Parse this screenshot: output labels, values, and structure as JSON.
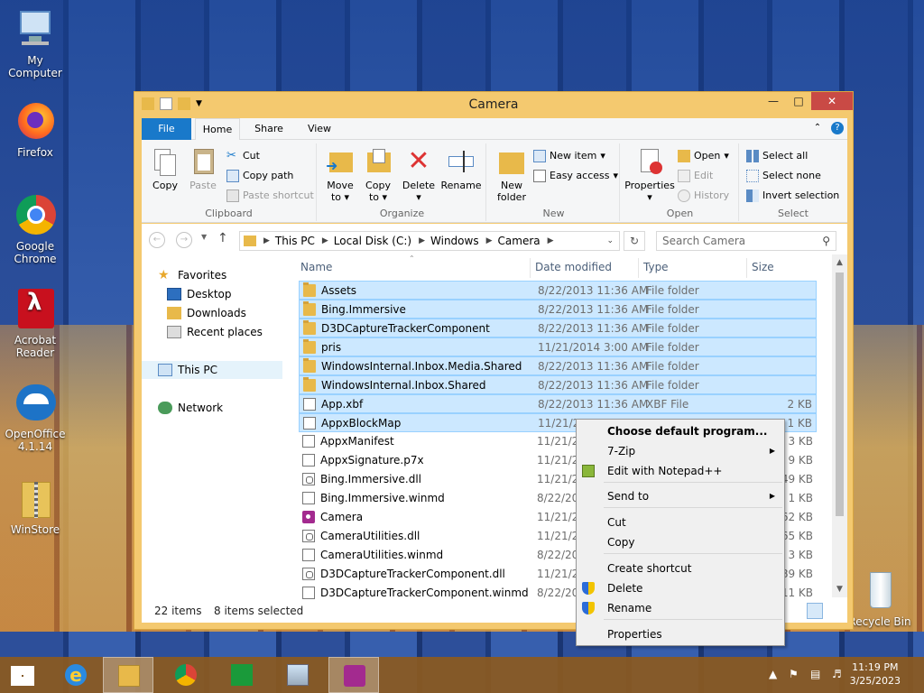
{
  "desktop": {
    "icons": [
      {
        "label": "My Computer"
      },
      {
        "label": "Firefox"
      },
      {
        "label": "Google Chrome"
      },
      {
        "label": "Acrobat Reader"
      },
      {
        "label": "OpenOffice 4.1.14"
      },
      {
        "label": "WinStore"
      },
      {
        "label": "Recycle Bin"
      }
    ]
  },
  "window": {
    "title": "Camera",
    "tabs": [
      {
        "label": "File"
      },
      {
        "label": "Home"
      },
      {
        "label": "Share"
      },
      {
        "label": "View"
      }
    ],
    "ribbon": {
      "clipboard": {
        "name": "Clipboard",
        "copy": "Copy",
        "paste": "Paste",
        "cut": "Cut",
        "copy_path": "Copy path",
        "paste_shortcut": "Paste shortcut"
      },
      "organize": {
        "name": "Organize",
        "move_to": "Move to",
        "copy_to": "Copy to",
        "delete": "Delete",
        "rename": "Rename"
      },
      "new": {
        "name": "New",
        "new_folder": "New folder",
        "new_item": "New item",
        "easy_access": "Easy access"
      },
      "open": {
        "name": "Open",
        "properties": "Properties",
        "open": "Open",
        "edit": "Edit",
        "history": "History"
      },
      "select": {
        "name": "Select",
        "select_all": "Select all",
        "select_none": "Select none",
        "invert_selection": "Invert selection"
      }
    },
    "address": {
      "segments": [
        "This PC",
        "Local Disk (C:)",
        "Windows",
        "Camera"
      ],
      "search_placeholder": "Search Camera"
    },
    "nav_pane": {
      "favorites": "Favorites",
      "desktop": "Desktop",
      "downloads": "Downloads",
      "recent_places": "Recent places",
      "this_pc": "This PC",
      "network": "Network"
    },
    "columns": {
      "name": "Name",
      "date": "Date modified",
      "type": "Type",
      "size": "Size"
    },
    "files": [
      {
        "name": "Assets",
        "date": "8/22/2013 11:36 AM",
        "type": "File folder",
        "size": "",
        "kind": "folder",
        "selected": true
      },
      {
        "name": "Bing.Immersive",
        "date": "8/22/2013 11:36 AM",
        "type": "File folder",
        "size": "",
        "kind": "folder",
        "selected": true
      },
      {
        "name": "D3DCaptureTrackerComponent",
        "date": "8/22/2013 11:36 AM",
        "type": "File folder",
        "size": "",
        "kind": "folder",
        "selected": true
      },
      {
        "name": "pris",
        "date": "11/21/2014 3:00 AM",
        "type": "File folder",
        "size": "",
        "kind": "folder",
        "selected": true
      },
      {
        "name": "WindowsInternal.Inbox.Media.Shared",
        "date": "8/22/2013 11:36 AM",
        "type": "File folder",
        "size": "",
        "kind": "folder",
        "selected": true
      },
      {
        "name": "WindowsInternal.Inbox.Shared",
        "date": "8/22/2013 11:36 AM",
        "type": "File folder",
        "size": "",
        "kind": "folder",
        "selected": true
      },
      {
        "name": "App.xbf",
        "date": "8/22/2013 11:36 AM",
        "type": "XBF File",
        "size": "2 KB",
        "kind": "file",
        "selected": true
      },
      {
        "name": "AppxBlockMap",
        "date": "11/21/20",
        "type": "",
        "size": "1 KB",
        "kind": "file",
        "selected": true
      },
      {
        "name": "AppxManifest",
        "date": "11/21/20",
        "type": "",
        "size": "3 KB",
        "kind": "file",
        "selected": false
      },
      {
        "name": "AppxSignature.p7x",
        "date": "11/21/20",
        "type": "",
        "size": "9 KB",
        "kind": "file",
        "selected": false
      },
      {
        "name": "Bing.Immersive.dll",
        "date": "11/21/20",
        "type": "",
        "size": "49 KB",
        "kind": "dll",
        "selected": false
      },
      {
        "name": "Bing.Immersive.winmd",
        "date": "8/22/20",
        "type": "",
        "size": "1 KB",
        "kind": "file",
        "selected": false
      },
      {
        "name": "Camera",
        "date": "11/21/20",
        "type": "",
        "size": "62 KB",
        "kind": "camera",
        "selected": false
      },
      {
        "name": "CameraUtilities.dll",
        "date": "11/21/20",
        "type": "",
        "size": "65 KB",
        "kind": "dll",
        "selected": false
      },
      {
        "name": "CameraUtilities.winmd",
        "date": "8/22/20",
        "type": "",
        "size": "3 KB",
        "kind": "file",
        "selected": false
      },
      {
        "name": "D3DCaptureTrackerComponent.dll",
        "date": "11/21/20",
        "type": "",
        "size": "89 KB",
        "kind": "dll",
        "selected": false
      },
      {
        "name": "D3DCaptureTrackerComponent.winmd",
        "date": "8/22/20",
        "type": "",
        "size": "11 KB",
        "kind": "file",
        "selected": false
      }
    ],
    "status": {
      "items": "22 items",
      "selected": "8 items selected"
    }
  },
  "context_menu": {
    "items": [
      {
        "label": "Choose default program...",
        "bold": true,
        "submenu": false,
        "icon": ""
      },
      {
        "label": "7-Zip",
        "bold": false,
        "submenu": true,
        "icon": ""
      },
      {
        "label": "Edit with Notepad++",
        "bold": false,
        "submenu": false,
        "icon": "notepadpp-icon"
      },
      {
        "label": "Send to",
        "bold": false,
        "submenu": true,
        "icon": ""
      },
      {
        "label": "Cut",
        "bold": false,
        "submenu": false,
        "icon": ""
      },
      {
        "label": "Copy",
        "bold": false,
        "submenu": false,
        "icon": ""
      },
      {
        "label": "Create shortcut",
        "bold": false,
        "submenu": false,
        "icon": ""
      },
      {
        "label": "Delete",
        "bold": false,
        "submenu": false,
        "icon": "shield-icon"
      },
      {
        "label": "Rename",
        "bold": false,
        "submenu": false,
        "icon": "shield-icon"
      },
      {
        "label": "Properties",
        "bold": false,
        "submenu": false,
        "icon": ""
      }
    ]
  },
  "taskbar": {
    "time": "11:19 PM",
    "date": "3/25/2023"
  },
  "colors": {
    "accent": "#1979ca",
    "selection": "#cce8ff",
    "window_frame": "#f4c96f",
    "close_button": "#c94a45"
  }
}
